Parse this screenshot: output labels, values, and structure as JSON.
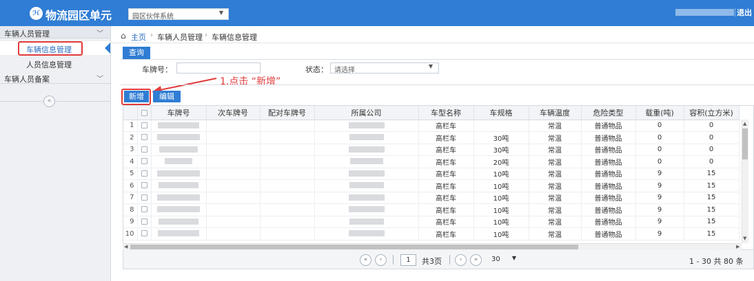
{
  "header": {
    "logo_glyph": "ℋ",
    "app_title": "物流园区单元",
    "system_select": "园区伙伴系统",
    "logout": "退出"
  },
  "sidebar": {
    "groups": [
      {
        "label": "车辆人员管理",
        "expanded": true,
        "items": [
          {
            "label": "车辆信息管理",
            "active": true
          },
          {
            "label": "人员信息管理",
            "active": false
          }
        ]
      },
      {
        "label": "车辆人员备案",
        "expanded": false,
        "items": []
      }
    ],
    "collapse_glyph": "«"
  },
  "breadcrumb": [
    "主页",
    "车辆人员管理",
    "车辆信息管理"
  ],
  "query": {
    "tab_label": "查询",
    "plate_label": "车牌号：",
    "plate_value": "",
    "status_label": "状态：",
    "status_value": "请选择"
  },
  "annotation": "1.点击 “新增”",
  "toolbar": {
    "add_label": "新增",
    "edit_label": "编辑"
  },
  "table": {
    "columns": [
      "车牌号",
      "次车牌号",
      "配对车牌号",
      "所属公司",
      "车型名称",
      "车规格",
      "车辆温度",
      "危险类型",
      "载重(吨)",
      "容积(立方米)"
    ],
    "rows": [
      {
        "idx": "1",
        "type": "高栏车",
        "spec": "",
        "temp": "常温",
        "danger": "普通物品",
        "load": "0",
        "volume": "0"
      },
      {
        "idx": "2",
        "type": "高栏车",
        "spec": "30吨",
        "temp": "常温",
        "danger": "普通物品",
        "load": "0",
        "volume": "0"
      },
      {
        "idx": "3",
        "type": "高栏车",
        "spec": "30吨",
        "temp": "常温",
        "danger": "普通物品",
        "load": "0",
        "volume": "0"
      },
      {
        "idx": "4",
        "type": "高栏车",
        "spec": "20吨",
        "temp": "常温",
        "danger": "普通物品",
        "load": "0",
        "volume": "0"
      },
      {
        "idx": "5",
        "type": "高栏车",
        "spec": "10吨",
        "temp": "常温",
        "danger": "普通物品",
        "load": "9",
        "volume": "15"
      },
      {
        "idx": "6",
        "type": "高栏车",
        "spec": "10吨",
        "temp": "常温",
        "danger": "普通物品",
        "load": "9",
        "volume": "15"
      },
      {
        "idx": "7",
        "type": "高栏车",
        "spec": "10吨",
        "temp": "常温",
        "danger": "普通物品",
        "load": "9",
        "volume": "15"
      },
      {
        "idx": "8",
        "type": "高栏车",
        "spec": "10吨",
        "temp": "常温",
        "danger": "普通物品",
        "load": "9",
        "volume": "15"
      },
      {
        "idx": "9",
        "type": "高栏车",
        "spec": "10吨",
        "temp": "常温",
        "danger": "普通物品",
        "load": "9",
        "volume": "15"
      },
      {
        "idx": "10",
        "type": "高栏车",
        "spec": "10吨",
        "temp": "常温",
        "danger": "普通物品",
        "load": "9",
        "volume": "15"
      }
    ]
  },
  "pager": {
    "first": "«",
    "prev": "‹",
    "next": "›",
    "last": "»",
    "page": "1",
    "total_pages": "共3页",
    "page_size": "30",
    "summary": "1 - 30  共 80 条"
  },
  "colors": {
    "brand": "#2f7dd4",
    "annotation": "#e23a3a"
  }
}
